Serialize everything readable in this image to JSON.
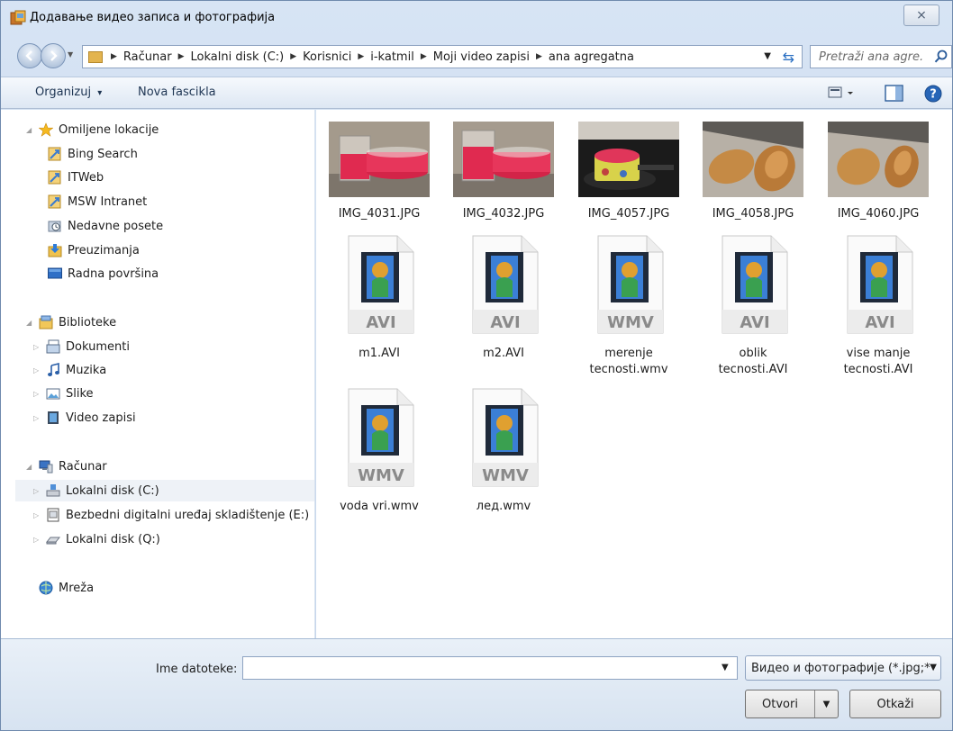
{
  "window": {
    "title": "Додавање видео записа и фотографија",
    "close_glyph": "⨯"
  },
  "address": {
    "crumbs": [
      "Računar",
      "Lokalni disk (C:)",
      "Korisnici",
      "i-katmil",
      "Moji video zapisi",
      "ana agregatna"
    ],
    "search_placeholder": "Pretraži ana agre..."
  },
  "toolbar": {
    "organize_label": "Organizuj",
    "organize_arrow": "▾",
    "new_folder_label": "Nova fascikla"
  },
  "navpane": {
    "favorites": {
      "label": "Omiljene lokacije",
      "items": [
        {
          "label": "Bing Search",
          "icon": "link-icon"
        },
        {
          "label": "ITWeb",
          "icon": "link-icon"
        },
        {
          "label": "MSW Intranet",
          "icon": "link-icon"
        },
        {
          "label": "Nedavne posete",
          "icon": "recent-places-icon"
        },
        {
          "label": "Preuzimanja",
          "icon": "downloads-icon"
        },
        {
          "label": "Radna površina",
          "icon": "desktop-icon"
        }
      ]
    },
    "libraries": {
      "label": "Biblioteke",
      "items": [
        {
          "label": "Dokumenti",
          "icon": "documents-icon"
        },
        {
          "label": "Muzika",
          "icon": "music-icon"
        },
        {
          "label": "Slike",
          "icon": "pictures-icon"
        },
        {
          "label": "Video zapisi",
          "icon": "videos-icon"
        }
      ]
    },
    "computer": {
      "label": "Računar",
      "items": [
        {
          "label": "Lokalni disk (C:)",
          "icon": "drive-icon",
          "selected": true
        },
        {
          "label": "Bezbedni digitalni uređaj skladištenje (E:)",
          "icon": "sd-card-icon"
        },
        {
          "label": "Lokalni disk (Q:)",
          "icon": "drive-icon"
        }
      ]
    },
    "network": {
      "label": "Mreža"
    }
  },
  "files": [
    {
      "name": "IMG_4031.JPG",
      "kind": "photo",
      "scene": "red-liquid-beakers"
    },
    {
      "name": "IMG_4032.JPG",
      "kind": "photo",
      "scene": "red-liquid-beakers"
    },
    {
      "name": "IMG_4057.JPG",
      "kind": "photo",
      "scene": "pot-on-stove"
    },
    {
      "name": "IMG_4058.JPG",
      "kind": "photo",
      "scene": "bread-loaves"
    },
    {
      "name": "IMG_4060.JPG",
      "kind": "photo",
      "scene": "bread-loaves"
    },
    {
      "name": "m1.AVI",
      "kind": "video",
      "format": "AVI"
    },
    {
      "name": "m2.AVI",
      "kind": "video",
      "format": "AVI"
    },
    {
      "name": "merenje tecnosti.wmv",
      "kind": "video",
      "format": "WMV"
    },
    {
      "name": "oblik tecnosti.AVI",
      "kind": "video",
      "format": "AVI"
    },
    {
      "name": "vise manje tecnosti.AVI",
      "kind": "video",
      "format": "AVI"
    },
    {
      "name": "voda vri.wmv",
      "kind": "video",
      "format": "WMV"
    },
    {
      "name": "лед.wmv",
      "kind": "video",
      "format": "WMV"
    }
  ],
  "bottom": {
    "filename_label": "Ime datoteke:",
    "filename_value": "",
    "filetype_value": "Видео и фотографије (*.jpg;*",
    "open_label": "Otvori",
    "cancel_label": "Otkaži"
  }
}
